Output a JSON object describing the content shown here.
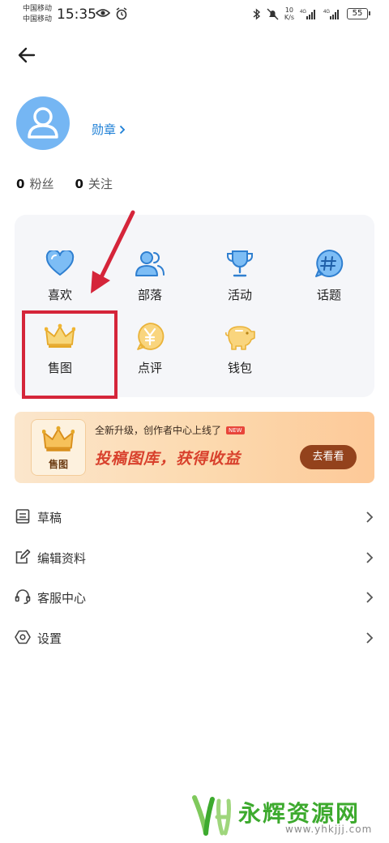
{
  "status_bar": {
    "carrier_1": "中国移动",
    "carrier_2": "中国移动",
    "time": "15:35",
    "net_speed_value": "10",
    "net_speed_unit": "K/s",
    "battery": "55"
  },
  "profile": {
    "medal_label": "勋章",
    "fans_count": "0",
    "fans_label": "粉丝",
    "following_count": "0",
    "following_label": "关注"
  },
  "grid": {
    "items": [
      {
        "label": "喜欢",
        "icon": "heart-icon"
      },
      {
        "label": "部落",
        "icon": "users-icon"
      },
      {
        "label": "活动",
        "icon": "trophy-icon"
      },
      {
        "label": "话题",
        "icon": "hashtag-icon"
      },
      {
        "label": "售图",
        "icon": "crown-icon"
      },
      {
        "label": "点评",
        "icon": "yen-bubble-icon"
      },
      {
        "label": "钱包",
        "icon": "piggy-bank-icon"
      }
    ]
  },
  "banner": {
    "badge_text": "售图",
    "subtitle": "全新升级，创作者中心上线了",
    "new_tag": "NEW",
    "title": "投稿图库，获得收益",
    "button_label": "去看看"
  },
  "menu": {
    "items": [
      {
        "label": "草稿",
        "icon": "draft-icon"
      },
      {
        "label": "编辑资料",
        "icon": "edit-icon"
      },
      {
        "label": "客服中心",
        "icon": "headset-icon"
      },
      {
        "label": "设置",
        "icon": "settings-icon"
      }
    ]
  },
  "watermark": {
    "title": "永辉资源网",
    "url": "www.yhkjjj.com"
  },
  "colors": {
    "accent_blue": "#1d7fd6",
    "icon_blue": "#4a9ee8",
    "gold": "#f0b533",
    "highlight_red": "#d5253a",
    "banner_button": "#93421c"
  }
}
